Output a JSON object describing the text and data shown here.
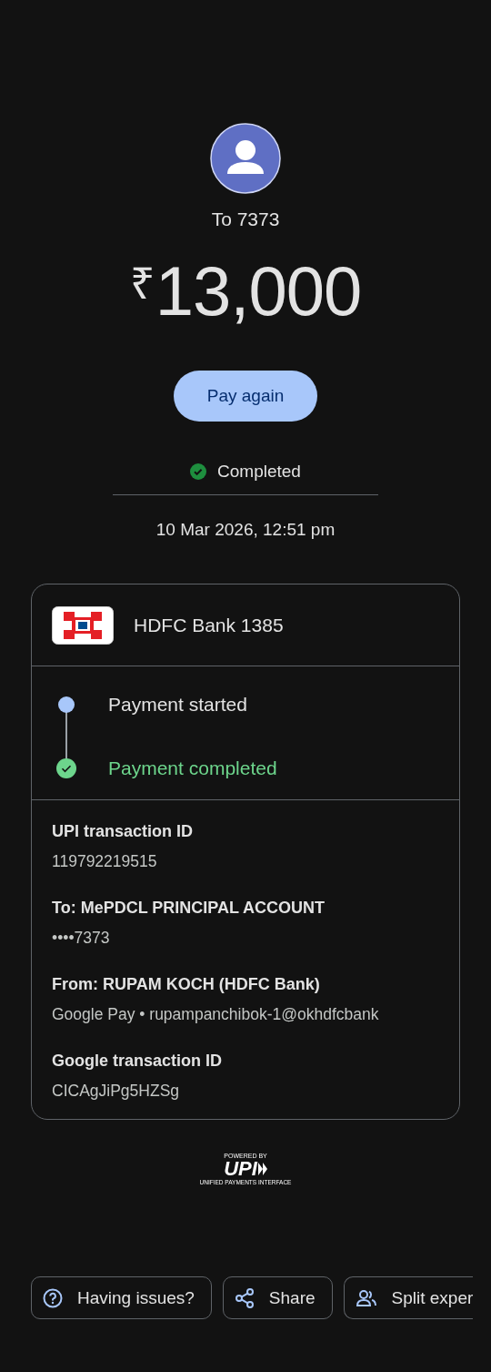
{
  "recipient": {
    "label": "To 7373"
  },
  "amount": {
    "currency": "₹",
    "value": "13,000"
  },
  "pay_again_button": "Pay again",
  "status": {
    "label": "Completed",
    "completed": true
  },
  "date": "10 Mar 2026, 12:51 pm",
  "card": {
    "bank": "HDFC Bank 1385",
    "timeline": [
      {
        "label": "Payment started",
        "kind": "started"
      },
      {
        "label": "Payment completed",
        "kind": "completed"
      }
    ],
    "details": [
      {
        "label": "UPI transaction ID",
        "value": "119792219515"
      },
      {
        "label": "To: MePDCL PRINCIPAL ACCOUNT",
        "value": "••••7373"
      },
      {
        "label": "From: RUPAM KOCH (HDFC Bank)",
        "value": "Google Pay • rupampanchibok-1@okhdfcbank"
      },
      {
        "label": "Google transaction ID",
        "value": "CICAgJiPg5HZSg"
      }
    ]
  },
  "upi_badge": {
    "powered_by": "POWERED BY",
    "logo": "UPI",
    "tagline": "UNIFIED PAYMENTS INTERFACE"
  },
  "actions": [
    {
      "label": "Having issues?",
      "kind": "help"
    },
    {
      "label": "Share",
      "kind": "share"
    },
    {
      "label": "Split exper",
      "kind": "split"
    }
  ]
}
